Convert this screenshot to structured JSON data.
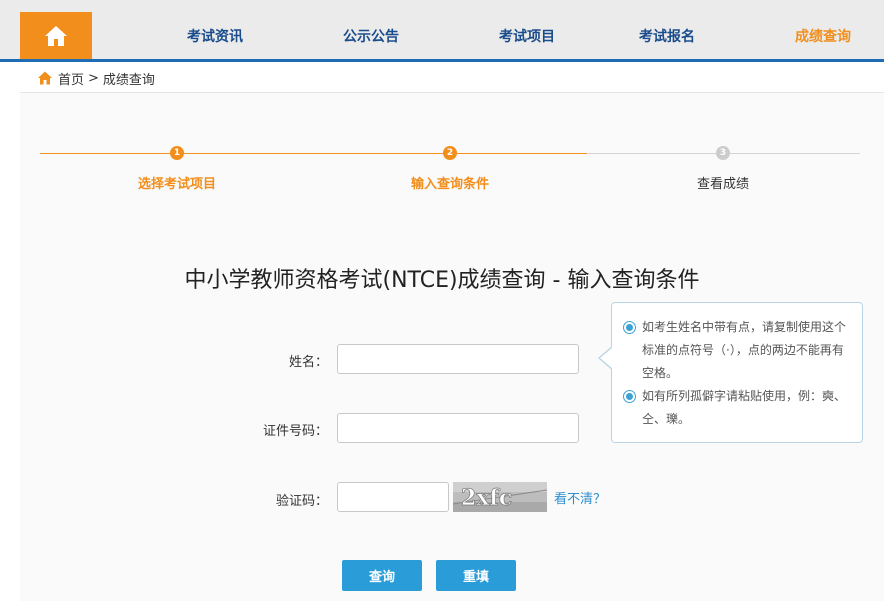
{
  "nav": {
    "home_icon": "home-icon",
    "items": [
      {
        "label": "考试资讯"
      },
      {
        "label": "公示公告"
      },
      {
        "label": "考试项目"
      },
      {
        "label": "考试报名"
      },
      {
        "label": "成绩查询",
        "active": true
      }
    ]
  },
  "breadcrumb": {
    "home": "首页",
    "separator": ">",
    "current": "成绩查询"
  },
  "steps": [
    {
      "number": "1",
      "label": "选择考试项目",
      "state": "done"
    },
    {
      "number": "2",
      "label": "输入查询条件",
      "state": "current"
    },
    {
      "number": "3",
      "label": "查看成绩",
      "state": "pending"
    }
  ],
  "page_title": "中小学教师资格考试(NTCE)成绩查询 - 输入查询条件",
  "form": {
    "name_label": "姓名：",
    "name_value": "",
    "id_label": "证件号码：",
    "id_value": "",
    "captcha_label": "验证码：",
    "captcha_value": "",
    "captcha_image_text": "2xfc",
    "refresh_link": "看不清？"
  },
  "tips": [
    "如考生姓名中带有点，请复制使用这个标准的点符号（·），点的两边不能再有空格。",
    "如有所列孤僻字请粘贴使用，例：奭、仝、瓅。"
  ],
  "buttons": {
    "query": "查询",
    "reset": "重填"
  },
  "colors": {
    "accent_orange": "#f28f1c",
    "nav_blue": "#1e6db4",
    "button_blue": "#2a9cd8",
    "step_pending": "#cccccc"
  }
}
